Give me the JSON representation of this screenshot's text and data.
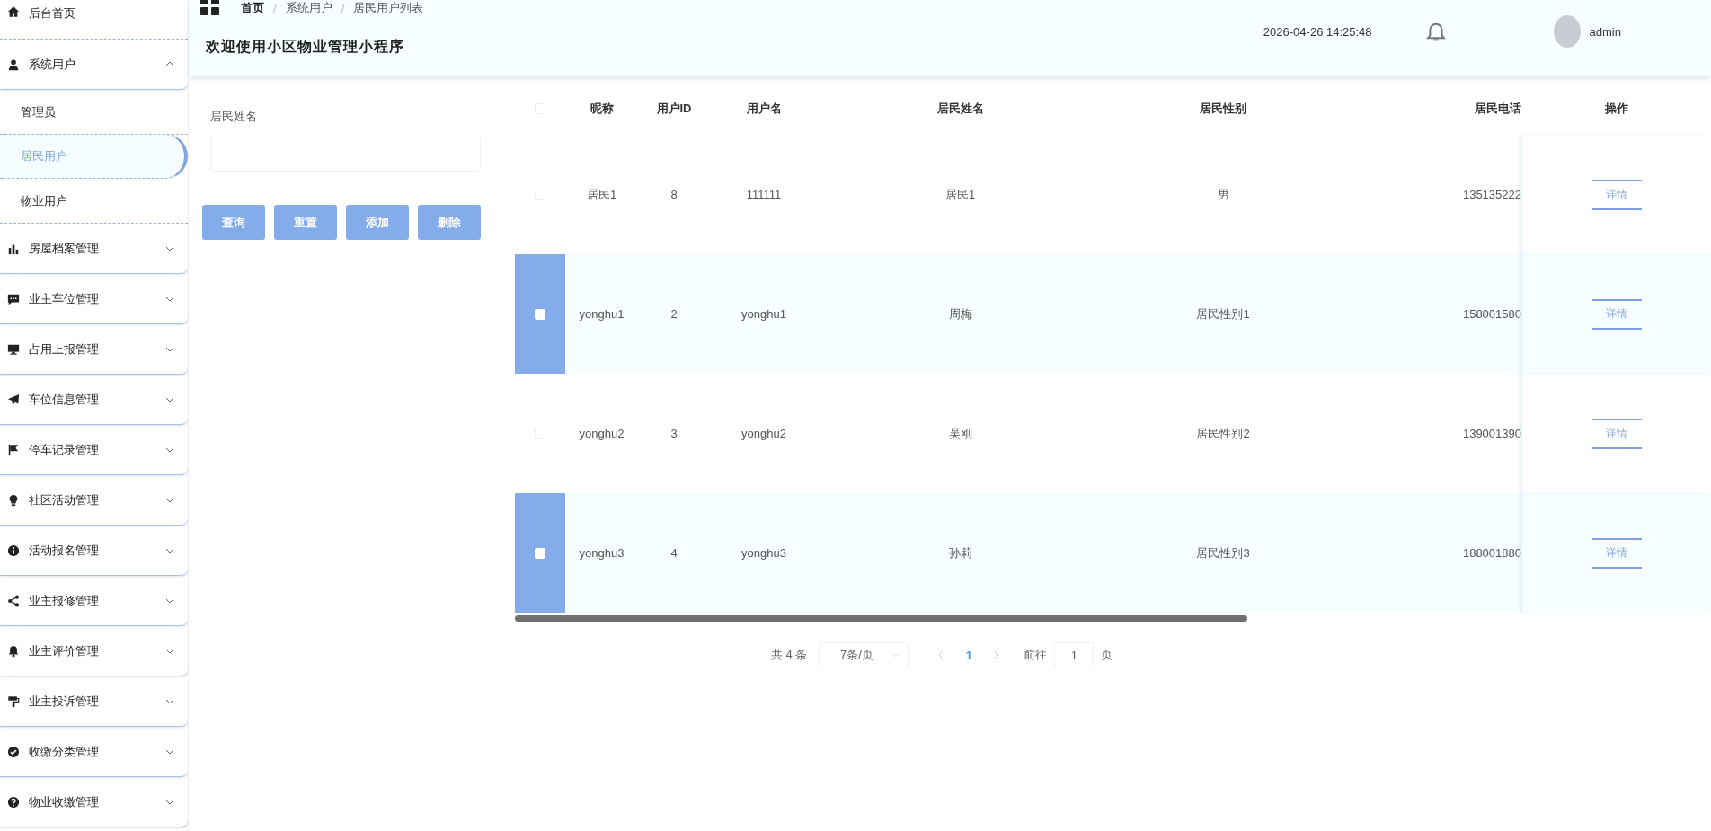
{
  "sidebar": {
    "items": [
      {
        "label": "后台首页",
        "kind": "link"
      },
      {
        "label": "系统用户",
        "kind": "group",
        "expanded": true,
        "children": [
          {
            "label": "管理员",
            "selected": false
          },
          {
            "label": "居民用户",
            "selected": true
          },
          {
            "label": "物业用户",
            "selected": false
          }
        ]
      },
      {
        "label": "房屋档案管理",
        "kind": "group",
        "expanded": false
      },
      {
        "label": "业主车位管理",
        "kind": "group",
        "expanded": false
      },
      {
        "label": "占用上报管理",
        "kind": "group",
        "expanded": false
      },
      {
        "label": "车位信息管理",
        "kind": "group",
        "expanded": false
      },
      {
        "label": "停车记录管理",
        "kind": "group",
        "expanded": false
      },
      {
        "label": "社区活动管理",
        "kind": "group",
        "expanded": false
      },
      {
        "label": "活动报名管理",
        "kind": "group",
        "expanded": false
      },
      {
        "label": "业主报修管理",
        "kind": "group",
        "expanded": false
      },
      {
        "label": "业主评价管理",
        "kind": "group",
        "expanded": false
      },
      {
        "label": "业主投诉管理",
        "kind": "group",
        "expanded": false
      },
      {
        "label": "收缴分类管理",
        "kind": "group",
        "expanded": false
      },
      {
        "label": "物业收缴管理",
        "kind": "group",
        "expanded": false
      }
    ]
  },
  "header": {
    "breadcrumb": [
      "首页",
      "系统用户",
      "居民用户列表"
    ],
    "breadcrumb_separator": "/",
    "title": "欢迎使用小区物业管理小程序",
    "datetime": "2026-04-26 14:25:48",
    "user": "admin"
  },
  "search": {
    "label": "居民姓名",
    "buttons": [
      "查询",
      "重置",
      "添加",
      "删除"
    ]
  },
  "table": {
    "select_all_checked": false,
    "columns": [
      "昵称",
      "用户ID",
      "用户名",
      "居民姓名",
      "居民性别",
      "居民电话",
      "操作"
    ],
    "rows": [
      {
        "cells": [
          "居民1",
          "8",
          "111111",
          "居民1",
          "男",
          "135135222"
        ],
        "action": "详情",
        "checked": false,
        "highlighted": false
      },
      {
        "cells": [
          "yonghu1",
          "2",
          "yonghu1",
          "周梅",
          "居民性别1",
          "158001580"
        ],
        "action": "详情",
        "checked": false,
        "highlighted": true
      },
      {
        "cells": [
          "yonghu2",
          "3",
          "yonghu2",
          "吴刚",
          "居民性别2",
          "139001390"
        ],
        "action": "详情",
        "checked": false,
        "highlighted": false
      },
      {
        "cells": [
          "yonghu3",
          "4",
          "yonghu3",
          "孙莉",
          "居民性别3",
          "188001880"
        ],
        "action": "详情",
        "checked": false,
        "highlighted": true
      }
    ]
  },
  "pagination": {
    "total": "共 4 条",
    "page_size": "7条/页",
    "pages": [
      {
        "label": "1",
        "selected": true
      }
    ],
    "goto_label": "前往",
    "goto_value": "1",
    "page_suffix": "页"
  }
}
